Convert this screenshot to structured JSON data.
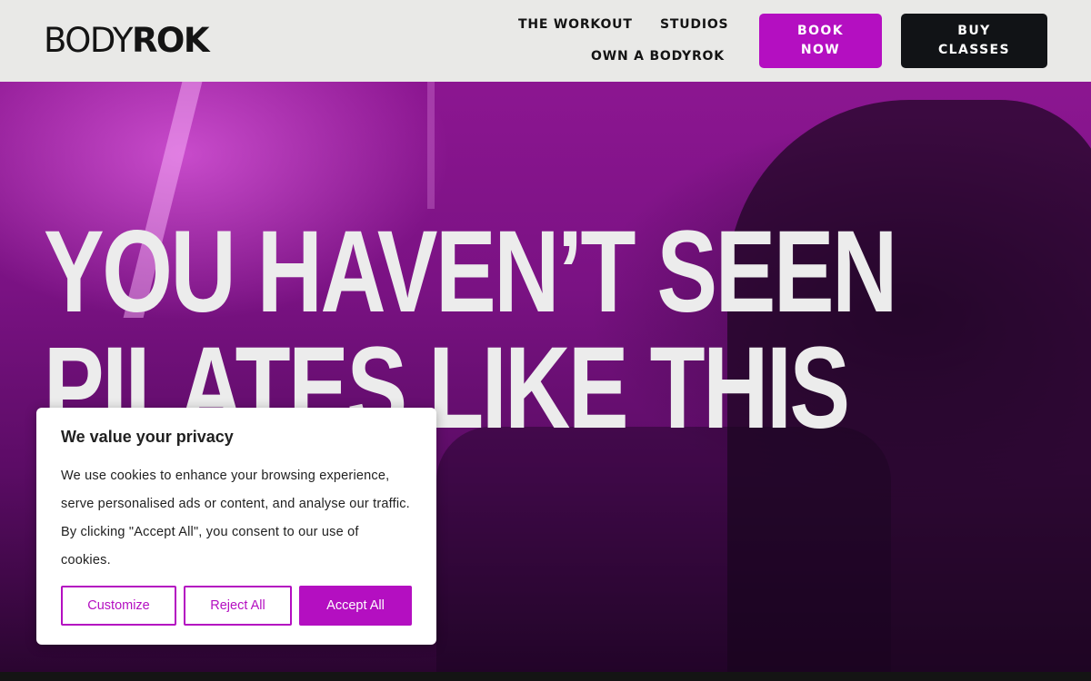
{
  "header": {
    "logo_light": "BODY",
    "logo_bold": "ROK",
    "nav": {
      "workout": "THE WORKOUT",
      "studios": "STUDIOS",
      "own": "OWN A BODYROK"
    },
    "book_now": "BOOK NOW",
    "buy_classes": "BUY CLASSES"
  },
  "hero": {
    "headline_line1": "YOU HAVEN’T SEEN",
    "headline_line2": "PILATES LIKE THIS"
  },
  "cookie_banner": {
    "title": "We value your privacy",
    "text": "We use cookies to enhance your browsing experience, serve personalised ads or content, and analyse our traffic. By clicking \"Accept All\", you consent to our use of cookies.",
    "customize": "Customize",
    "reject_all": "Reject All",
    "accept_all": "Accept All"
  },
  "colors": {
    "brand_purple": "#b40fc1",
    "header_bg": "#e9e9e7",
    "dark_button": "#111316"
  }
}
